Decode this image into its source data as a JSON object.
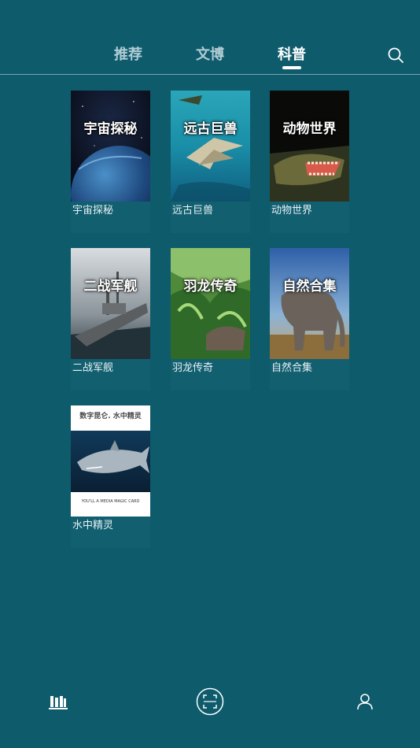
{
  "top_tabs": [
    {
      "label": "推荐",
      "active": false
    },
    {
      "label": "文博",
      "active": false
    },
    {
      "label": "科普",
      "active": true
    }
  ],
  "header": {
    "search_icon": "search-icon"
  },
  "cards": [
    {
      "cover_title": "宇宙探秘",
      "label": "宇宙探秘"
    },
    {
      "cover_title": "远古巨兽",
      "label": "远古巨兽"
    },
    {
      "cover_title": "动物世界",
      "label": "动物世界"
    },
    {
      "cover_title": "二战军舰",
      "label": "二战军舰"
    },
    {
      "cover_title": "羽龙传奇",
      "label": "羽龙传奇"
    },
    {
      "cover_title": "自然合集",
      "label": "自然合集"
    },
    {
      "cover_title": "数字昆仑. 水中精灵",
      "cover_subtitle": "YOU'LL A MEDIA MAGIC CARD",
      "label": "水中精灵"
    }
  ],
  "bottom_nav": {
    "items": [
      {
        "icon": "library-icon",
        "active": true
      },
      {
        "icon": "scan-icon",
        "active": false
      },
      {
        "icon": "profile-icon",
        "active": false
      }
    ]
  },
  "colors": {
    "background": "#0e5b6c",
    "card_bg": "#125f70",
    "text": "#ffffff"
  }
}
